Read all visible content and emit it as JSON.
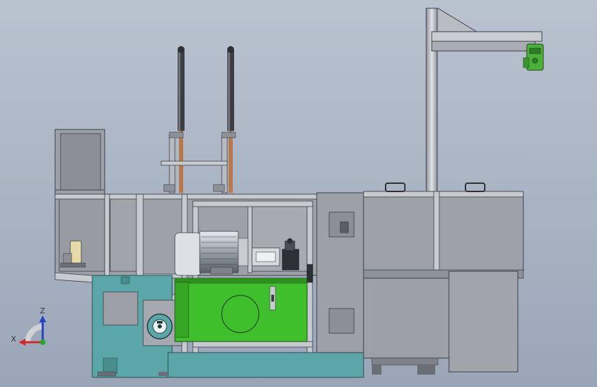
{
  "viewport": {
    "background_top": "#b9c2cf",
    "background_bottom": "#9aa6b8"
  },
  "colors": {
    "frame": "#b8bcc2",
    "frame_edge": "#3a3d42",
    "panel_gray": "#9da1a7",
    "panel_dark": "#7f8389",
    "base_teal": "#5aa6a8",
    "tank_green": "#3fbf2c",
    "tank_green_dark": "#2c8f1e",
    "clamp_green": "#4caf3a",
    "cylinder_dark": "#3a3d42",
    "rod_copper": "#b9774a"
  },
  "icons": {
    "triad": "coordinate-triad-icon"
  },
  "triad": {
    "x_label": "X",
    "y_label": "Z"
  }
}
